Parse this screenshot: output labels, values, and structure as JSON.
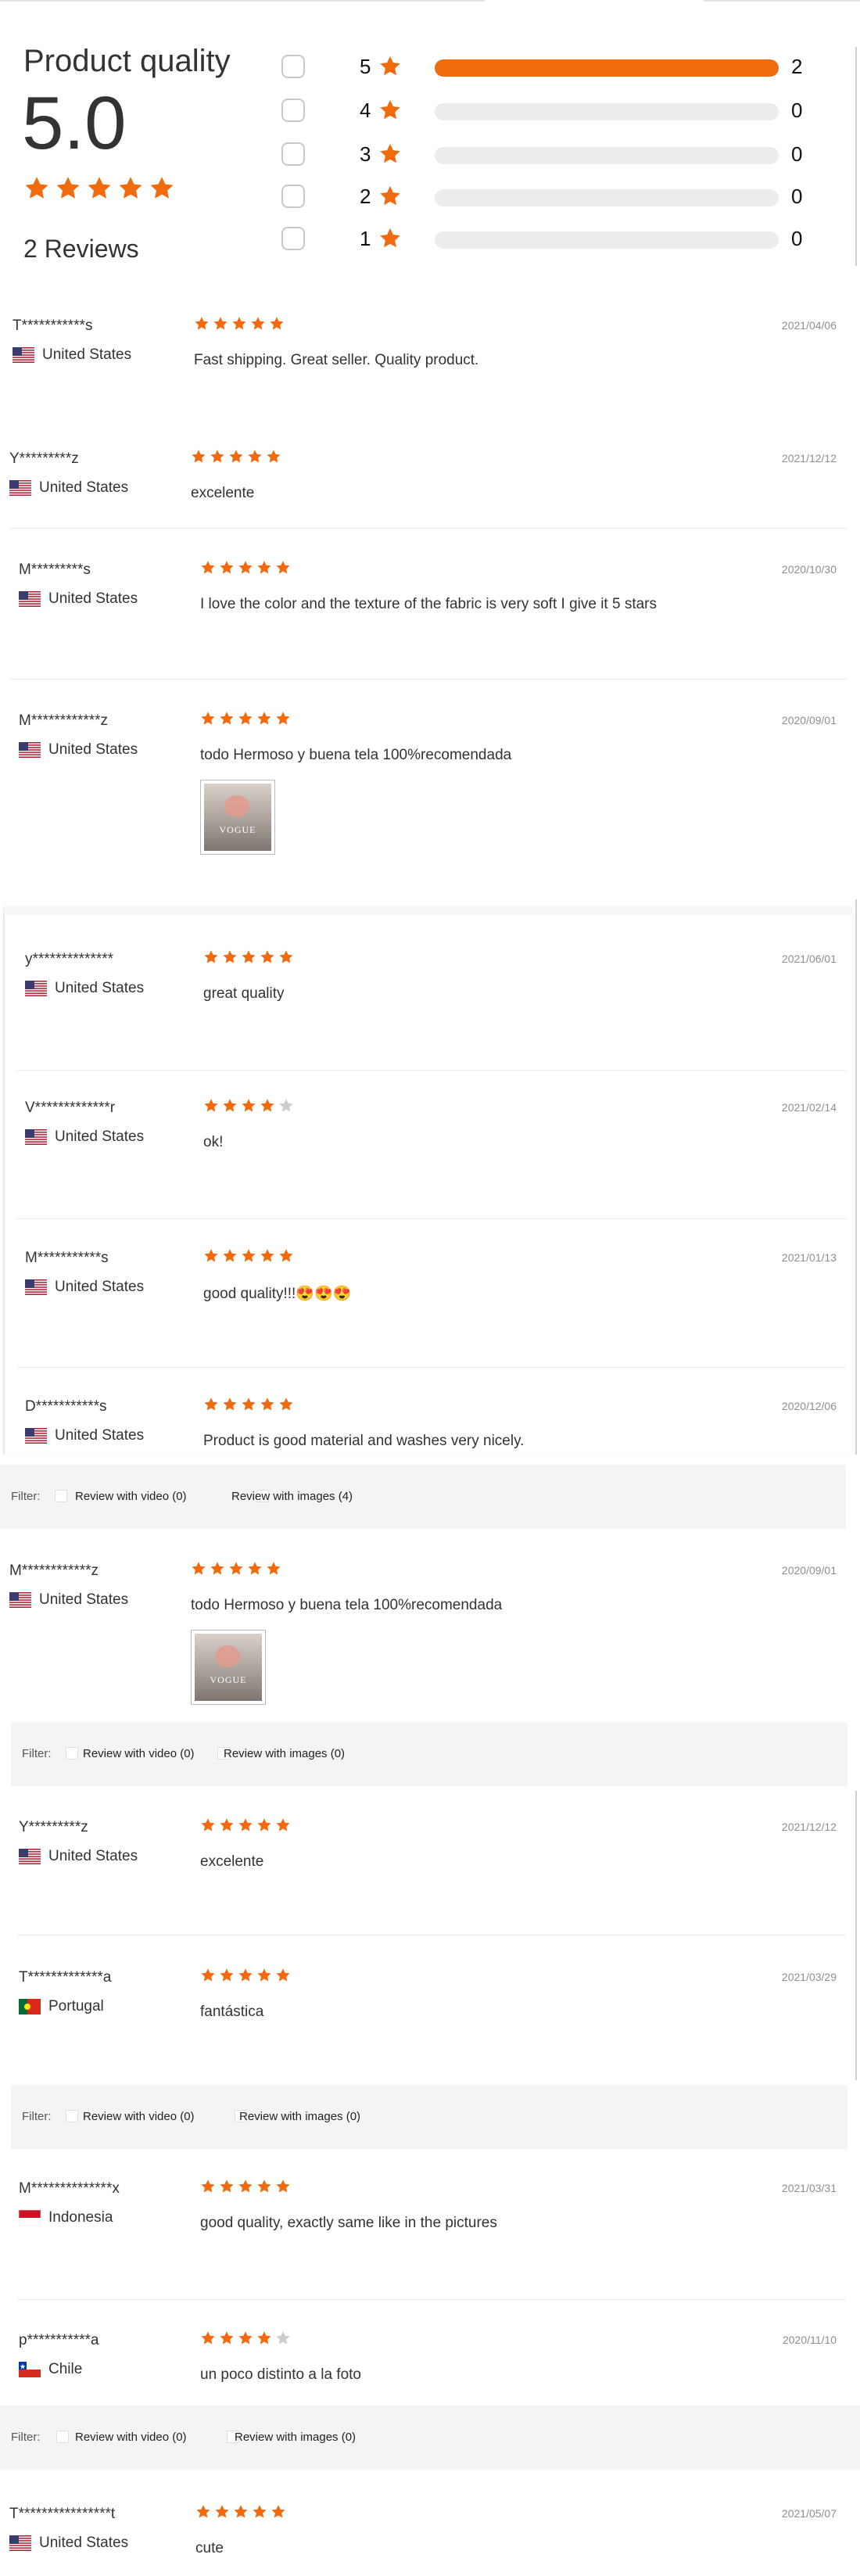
{
  "summary": {
    "title": "Product quality",
    "score": "5.0",
    "reviews_label": "2 Reviews",
    "rows": [
      {
        "label": "5",
        "count": "2",
        "fill": 1.0
      },
      {
        "label": "4",
        "count": "0",
        "fill": 0
      },
      {
        "label": "3",
        "count": "0",
        "fill": 0
      },
      {
        "label": "2",
        "count": "0",
        "fill": 0
      },
      {
        "label": "1",
        "count": "0",
        "fill": 0
      }
    ]
  },
  "colors": {
    "accent": "#f26a0e",
    "star_off": "#cccccc",
    "date": "#8e8e8e",
    "filter_bg": "#f4f4f4"
  },
  "icons": {
    "star": "star-icon",
    "flag_us": "us-flag-icon",
    "flag_pt": "portugal-flag-icon",
    "flag_id": "indonesia-flag-icon",
    "flag_cl": "chile-flag-icon"
  },
  "reviews": [
    {
      "name": "T***********s",
      "country": "United States",
      "date": "2021/04/06",
      "text": "Fast shipping. Great seller. Quality product.",
      "stars": 5
    },
    {
      "name": "Y*********z",
      "country": "United States",
      "date": "2021/12/12",
      "text": "excelente",
      "stars": 5
    },
    {
      "name": "M*********s",
      "country": "United States",
      "date": "2020/10/30",
      "text": "I love the color and the texture of the fabric is very soft I give it 5 stars",
      "stars": 5
    },
    {
      "name": "M************z",
      "country": "United States",
      "date": "2020/09/01",
      "text": "todo Hermoso y buena tela 100%recomendada",
      "stars": 5,
      "image_text": "VOGUE"
    },
    {
      "name": "y**************",
      "country": "United States",
      "date": "2021/06/01",
      "text": "great quality",
      "stars": 5
    },
    {
      "name": "V*************r",
      "country": "United States",
      "date": "2021/02/14",
      "text": "ok!",
      "stars": 4
    },
    {
      "name": "M***********s",
      "country": "United States",
      "date": "2021/01/13",
      "text": "good quality!!!😍😍😍",
      "stars": 5
    },
    {
      "name": "D***********s",
      "country": "United States",
      "date": "2020/12/06",
      "text": "Product is good material and washes very nicely.",
      "stars": 5
    },
    {
      "name": "M************z",
      "country": "United States",
      "date": "2020/09/01",
      "text": "todo Hermoso y buena tela 100%recomendada",
      "stars": 5,
      "image_text": "VOGUE"
    },
    {
      "name": "Y*********z",
      "country": "United States",
      "date": "2021/12/12",
      "text": "excelente",
      "stars": 5
    },
    {
      "name": "T*************a",
      "country": "Portugal",
      "date": "2021/03/29",
      "text": "fantástica",
      "stars": 5
    },
    {
      "name": "M**************x",
      "country": "Indonesia",
      "date": "2021/03/31",
      "text": "good quality, exactly same like in the pictures",
      "stars": 5
    },
    {
      "name": "p***********a",
      "country": "Chile",
      "date": "2020/11/10",
      "text": "un poco distinto a la foto",
      "stars": 4
    },
    {
      "name": "T****************t",
      "country": "United States",
      "date": "2021/05/07",
      "text": "cute",
      "stars": 5
    }
  ],
  "filters": [
    {
      "label": "Filter:",
      "video": "Review with video (0)",
      "images": "Review with images (4)"
    },
    {
      "label": "Filter:",
      "video": "Review with video (0)",
      "images": "Review with images (0)"
    },
    {
      "label": "Filter:",
      "video": "Review with video (0)",
      "images": "Review with images (0)"
    },
    {
      "label": "Filter:",
      "video": "Review with video (0)",
      "images": "Review with images (0)"
    }
  ]
}
